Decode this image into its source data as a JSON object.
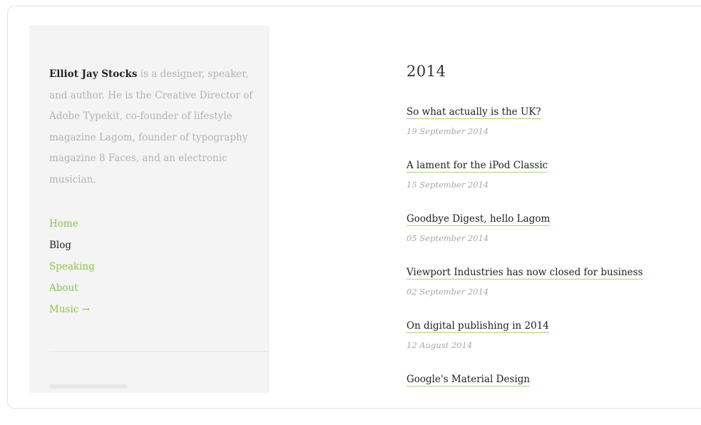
{
  "sidebar": {
    "author_name": "Elliot Jay Stocks",
    "bio_text": " is a designer, speaker, and author. He is the Creative Director of Adobe Typekit, co-founder of lifestyle magazine Lagom, founder of typography magazine 8 Faces, and an electronic musician.",
    "nav": [
      {
        "label": "Home",
        "current": false
      },
      {
        "label": "Blog",
        "current": true
      },
      {
        "label": "Speaking",
        "current": false
      },
      {
        "label": "About",
        "current": false
      },
      {
        "label": "Music →",
        "current": false
      }
    ]
  },
  "main": {
    "year_heading": "2014",
    "posts": [
      {
        "title": "So what actually is the UK?",
        "date": "19 September 2014"
      },
      {
        "title": "A lament for the iPod Classic",
        "date": "15 September 2014"
      },
      {
        "title": "Goodbye Digest, hello Lagom",
        "date": "05 September 2014"
      },
      {
        "title": "Viewport Industries has now closed for business",
        "date": "02 September 2014"
      },
      {
        "title": "On digital publishing in 2014",
        "date": "12 August 2014"
      },
      {
        "title": "Google's Material Design",
        "date": ""
      }
    ]
  },
  "colors": {
    "accent_green": "#8cc34a",
    "underline_green": "#a9d57a",
    "sidebar_bg": "#f4f4f4",
    "muted_text": "#b3b3b3"
  }
}
